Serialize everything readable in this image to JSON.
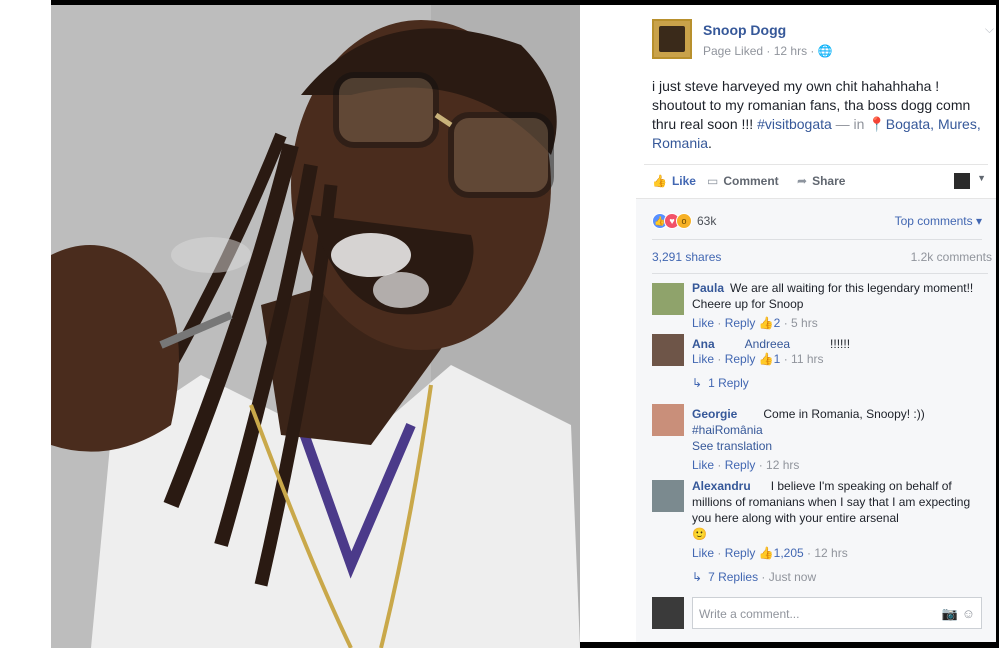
{
  "post": {
    "page_name": "Snoop Dogg",
    "meta": "Page Liked · 12 hrs · ",
    "globe_icon": "globe-icon",
    "text_main": "i just steve harveyed my own chit hahahhaha ! shoutout to my romanian fans, tha boss dogg comn thru real soon !!! ",
    "hashtag": "#visitbogata",
    "in_label": " — in ",
    "location": "Bogata, Mures, Romania",
    "location_end": "."
  },
  "actions": {
    "like": "Like",
    "comment": "Comment",
    "share": "Share"
  },
  "stats": {
    "reactions_count": "63k",
    "top_comments": "Top comments ▾",
    "shares": "3,291 shares",
    "comments_count": "1.2k comments"
  },
  "comments": [
    {
      "name": "Paula",
      "text": "We are all waiting for this legendary moment!! Cheere up for Snoop",
      "like": "Like",
      "reply": "Reply",
      "likes": "2",
      "time": "5 hrs"
    },
    {
      "name": "Ana",
      "tag": "Andreea",
      "text": "!!!!!!",
      "like": "Like",
      "reply": "Reply",
      "likes": "1",
      "time": "11 hrs",
      "replies": "1 Reply"
    },
    {
      "name": "Georgie",
      "text": "Come in Romania, Snoopy! :))",
      "hashtag": "#haiRomânia",
      "see_translation": "See translation",
      "like": "Like",
      "reply": "Reply",
      "time": "12 hrs"
    },
    {
      "name": "Alexandru",
      "text": "I believe I'm speaking on behalf of millions of romanians when I say that I am expecting you here along with your entire arsenal",
      "emoji": "🙂",
      "like": "Like",
      "reply": "Reply",
      "likes": "1,205",
      "time": "12 hrs",
      "replies": "7 Replies",
      "replies_time": "Just now"
    }
  ],
  "composer": {
    "placeholder": "Write a comment..."
  }
}
